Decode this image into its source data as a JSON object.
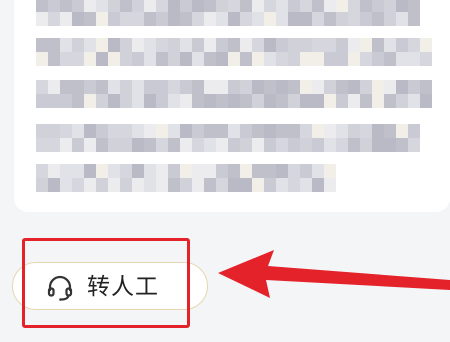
{
  "quick_actions": {
    "transfer_label": "转人工",
    "transfer_icon": "headset-icon"
  },
  "colors": {
    "highlight": "#e3222a",
    "button_border": "#e6d7b0",
    "background": "#f4f5f7"
  }
}
